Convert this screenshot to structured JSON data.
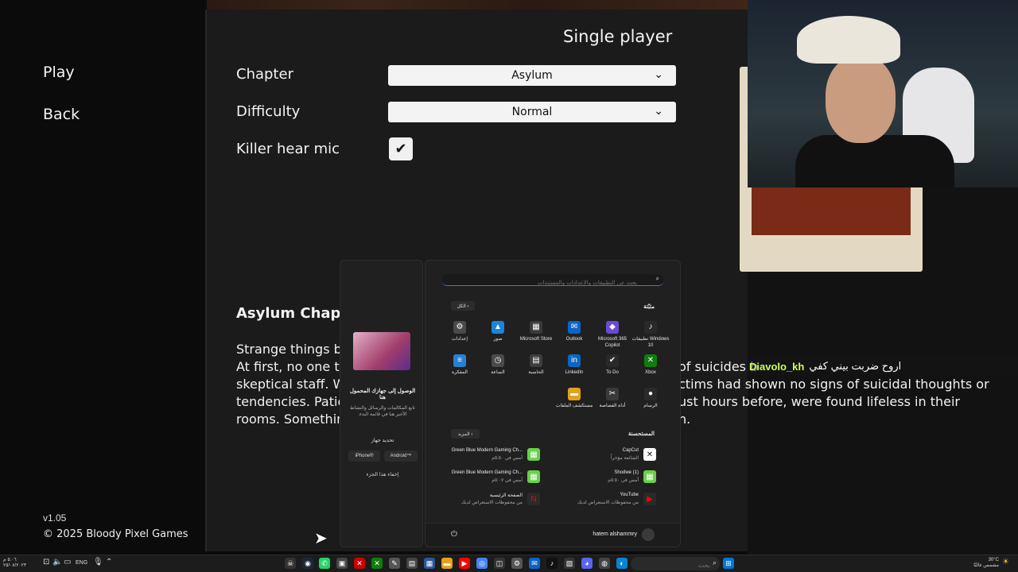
{
  "game": {
    "menu": {
      "play": "Play",
      "back": "Back"
    },
    "mode_title": "Single player",
    "options": {
      "chapter_label": "Chapter",
      "chapter_value": "Asylum",
      "difficulty_label": "Difficulty",
      "difficulty_value": "Normal",
      "killer_mic_label": "Killer hear mic",
      "killer_mic_checked": true
    },
    "chapter_heading": "Asylum Chapter",
    "story_lines": [
      "Strange things be",
      "At first, no one th",
      "skeptical staff. Wh",
      "tendencies. Patien",
      "rooms. Something"
    ],
    "story_right_lines": [
      "of suicides b",
      "ctims had shown no signs of suicidal thoughts or",
      "ust hours before, were found lifeless in their",
      "n."
    ],
    "version": "v1.05",
    "copyright": "© 2025 Bloody Pixel Games"
  },
  "chat": {
    "username": "Diavolo_kh",
    "message": "اروح ضربت بيني كفي"
  },
  "start_menu": {
    "search_placeholder": "بحث عن التطبيقات والإعدادات والمستندات",
    "pinned_title": "مثبّتة",
    "all_label": "الكل ‹",
    "pinned_apps": [
      {
        "name": "تطبيقات Windows 10",
        "icon": "tiktok-icon",
        "color": "#2a2a2a",
        "glyph": "♪"
      },
      {
        "name": "Microsoft 365 Copilot",
        "icon": "copilot-icon",
        "color": "#6b4bd6",
        "glyph": "◆"
      },
      {
        "name": "Outlook",
        "icon": "outlook-icon",
        "color": "#0a64c9",
        "glyph": "✉"
      },
      {
        "name": "Microsoft Store",
        "icon": "store-icon",
        "color": "#3a3a3a",
        "glyph": "▦"
      },
      {
        "name": "صور",
        "icon": "photos-icon",
        "color": "#1a86d9",
        "glyph": "▲"
      },
      {
        "name": "إعدادات",
        "icon": "settings-icon",
        "color": "#4a4a4a",
        "glyph": "⚙"
      },
      {
        "name": "Xbox",
        "icon": "xbox-icon",
        "color": "#107c10",
        "glyph": "✕"
      },
      {
        "name": "To Do",
        "icon": "todo-icon",
        "color": "#2a2a2a",
        "glyph": "✔"
      },
      {
        "name": "LinkedIn",
        "icon": "linkedin-icon",
        "color": "#0a66c2",
        "glyph": "in"
      },
      {
        "name": "الحاسبة",
        "icon": "calculator-icon",
        "color": "#3d3d3d",
        "glyph": "▤"
      },
      {
        "name": "الساعة",
        "icon": "clock-icon",
        "color": "#4a4a4a",
        "glyph": "◷"
      },
      {
        "name": "المفكرة",
        "icon": "notepad-icon",
        "color": "#2a7fd0",
        "glyph": "≡"
      },
      {
        "name": "الرسام",
        "icon": "paint-icon",
        "color": "#2a2a2a",
        "glyph": "●"
      },
      {
        "name": "أداة القصاصة",
        "icon": "snipping-tool-icon",
        "color": "#3a3a3a",
        "glyph": "✂"
      },
      {
        "name": "مستكشف الملفات",
        "icon": "file-explorer-icon",
        "color": "#e3a21a",
        "glyph": "▬"
      }
    ],
    "recommended_title": "المستحسنة",
    "more_label": "المزيد ‹",
    "recommended": [
      {
        "name": "CapCut",
        "sub": "الشائعة مؤخراً",
        "icon": "capcut-icon",
        "side": "right"
      },
      {
        "name": "Green Blue Modern Gaming Ch...",
        "sub": "أمس في ٥:٥٠م",
        "icon": "canva-icon",
        "side": "left"
      },
      {
        "name": "Shodwe (1)",
        "sub": "أمس في ٥:٥٠م",
        "icon": "canva-icon",
        "side": "right"
      },
      {
        "name": "Green Blue Modern Gaming Ch...",
        "sub": "أمس في ٥:٠٧م",
        "icon": "canva-icon",
        "side": "left"
      },
      {
        "name": "YouTube",
        "sub": "من محفوظات الاستعراض لديك",
        "icon": "youtube-icon",
        "side": "right"
      },
      {
        "name": "الصفحة الرئيسية",
        "sub": "من محفوظات الاستعراض لديك",
        "icon": "netflix-icon",
        "side": "left"
      }
    ],
    "user_name": "hatem alshammry"
  },
  "phone_widget": {
    "title": "الوصول إلى جهازك المحمول هنا",
    "desc": "تابع المكالمات والرسائل والنشاط الأخير هنا في قائمة البدء.",
    "pair": "تحديد جهاز",
    "iphone": "iPhone®",
    "android": "Android™",
    "hide": "إخفاء هذا الجزء"
  },
  "taskbar": {
    "lang": "ENG",
    "search_placeholder": "بحث",
    "weather_temp": "30°C",
    "weather_desc": "مشمس غالبًا"
  }
}
